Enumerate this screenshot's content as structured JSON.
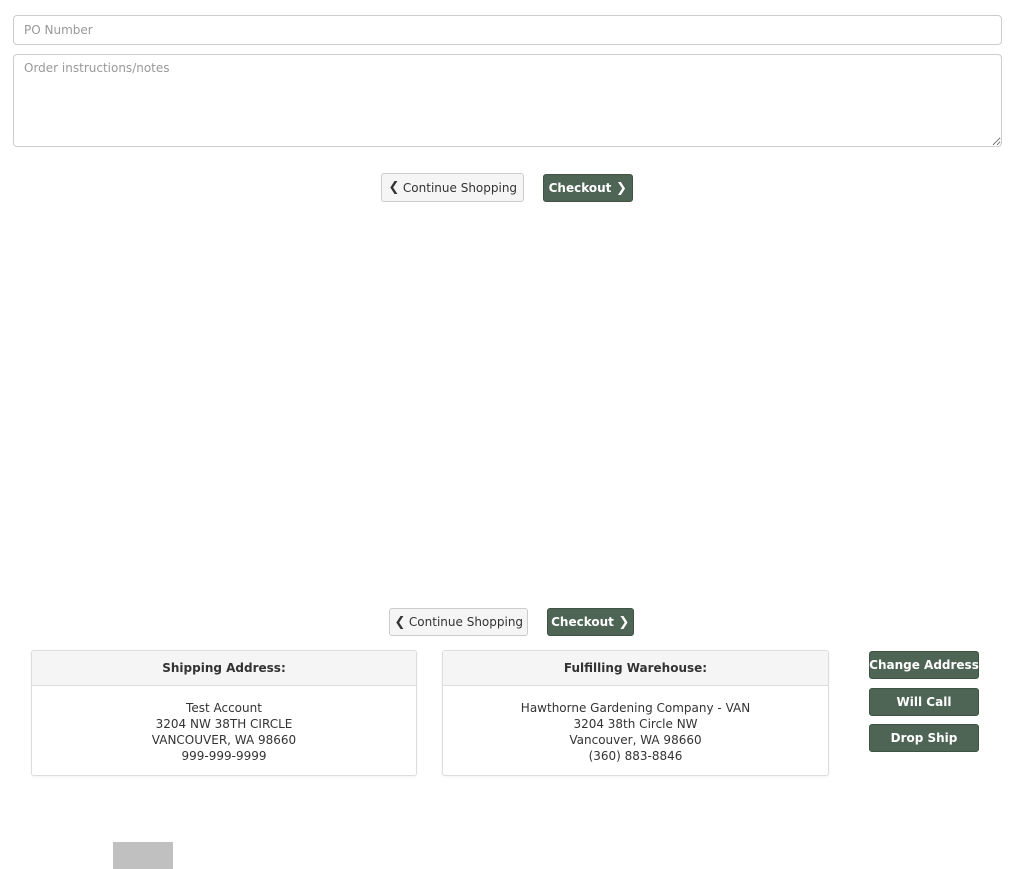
{
  "order_form": {
    "po_placeholder": "PO Number",
    "po_value": "",
    "notes_placeholder": "Order instructions/notes",
    "notes_value": ""
  },
  "actions_top": {
    "continue_label": "Continue Shopping",
    "checkout_label": "Checkout"
  },
  "actions_bottom": {
    "continue_label": "Continue Shopping",
    "checkout_label": "Checkout"
  },
  "icons": {
    "continue": "chevron-left-icon",
    "checkout": "chevron-right-icon"
  },
  "shipping": {
    "title": "Shipping Address:",
    "lines": [
      "Test Account",
      "3204 NW 38TH CIRCLE",
      "VANCOUVER, WA 98660",
      "999-999-9999"
    ]
  },
  "warehouse": {
    "title": "Fulfilling Warehouse:",
    "lines": [
      "Hawthorne Gardening Company - VAN",
      "3204 38th Circle NW",
      "Vancouver, WA 98660",
      "(360) 883-8846"
    ]
  },
  "side_actions": {
    "change_address": "Change Address",
    "will_call": "Will Call",
    "drop_ship": "Drop Ship"
  },
  "colors": {
    "primary_button": "#4e6454",
    "default_button": "#f5f5f5",
    "panel_heading": "#f5f5f5",
    "placeholder_block": "#c0c0c0"
  }
}
